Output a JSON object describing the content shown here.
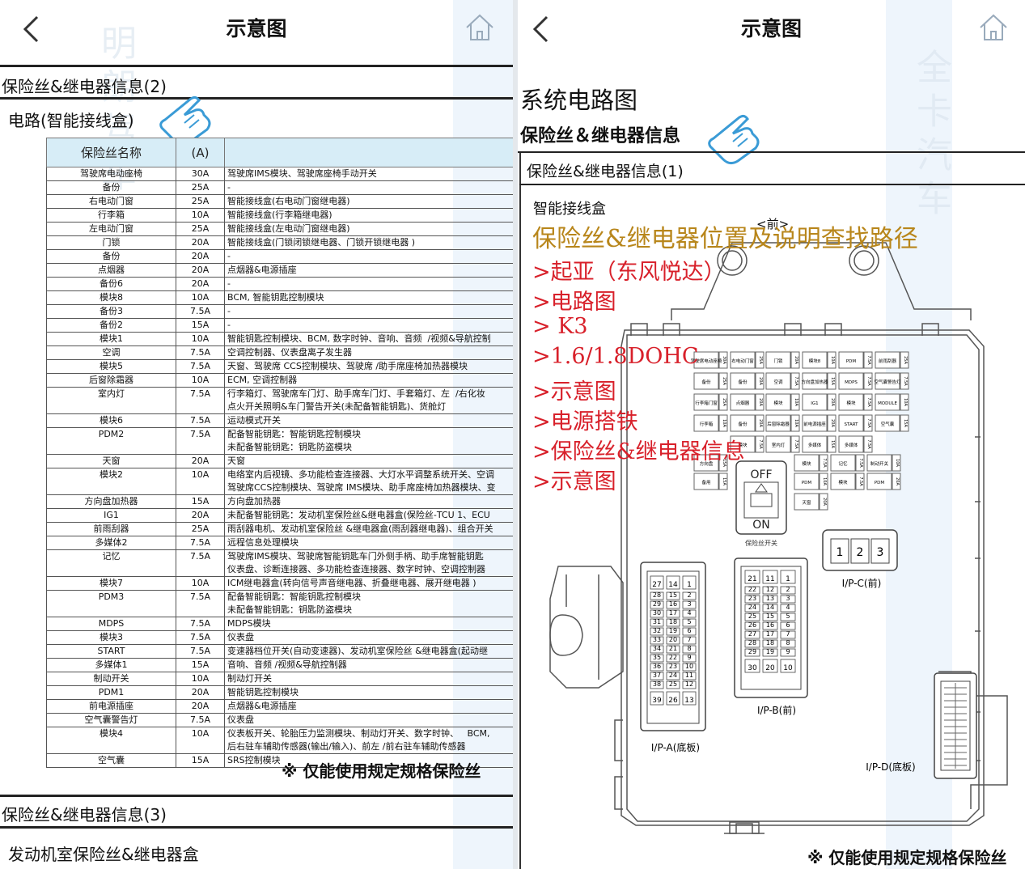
{
  "left_screen": {
    "header": {
      "title": "示意图",
      "back_icon": "chevron-left-icon",
      "home_icon": "home-icon"
    },
    "section_title": "保险丝&继电器信息(2)",
    "subtitle": "电路(智能接线盒)",
    "table": {
      "columns": [
        "保险丝名称",
        "(A)",
        ""
      ],
      "rows": [
        {
          "name": "驾驶席电动座椅",
          "amp": "30A",
          "desc": "驾驶席IMS模块、驾驶席座椅手动开关"
        },
        {
          "name": "备份",
          "amp": "25A",
          "desc": "-"
        },
        {
          "name": "右电动门窗",
          "amp": "25A",
          "desc": "智能接线盒(右电动门窗继电器)"
        },
        {
          "name": "行李箱",
          "amp": "10A",
          "desc": "智能接线盒(行李箱继电器)"
        },
        {
          "name": "左电动门窗",
          "amp": "25A",
          "desc": "智能接线盒(左电动门窗继电器)"
        },
        {
          "name": "门锁",
          "amp": "20A",
          "desc": "智能接线盒(门锁闭锁继电器、门锁开锁继电器 )"
        },
        {
          "name": "备份",
          "amp": "20A",
          "desc": "-"
        },
        {
          "name": "点烟器",
          "amp": "20A",
          "desc": "点烟器&电源插座"
        },
        {
          "name": "备份6",
          "amp": "20A",
          "desc": "-"
        },
        {
          "name": "模块8",
          "amp": "10A",
          "desc": "BCM, 智能钥匙控制模块"
        },
        {
          "name": "备份3",
          "amp": "7.5A",
          "desc": "-"
        },
        {
          "name": "备份2",
          "amp": "15A",
          "desc": "-"
        },
        {
          "name": "模块1",
          "amp": "10A",
          "desc": "智能钥匙控制模块、BCM, 数字时钟、音响、音频  /视频&导航控制"
        },
        {
          "name": "空调",
          "amp": "7.5A",
          "desc": "空调控制器、仪表盘离子发生器"
        },
        {
          "name": "模块5",
          "amp": "7.5A",
          "desc": "天窗、驾驶席 CCS控制模块、驾驶席 /助手席座椅加热器模块"
        },
        {
          "name": "后窗除霜器",
          "amp": "10A",
          "desc": "ECM, 空调控制器"
        },
        {
          "name": "室内灯",
          "amp": "7.5A",
          "desc": "行李箱灯、驾驶席车门灯、助手席车门灯、手套箱灯、左  /右化妆\n点火开关照明&车门警告开关(未配备智能钥匙)、货舱灯"
        },
        {
          "name": "模块6",
          "amp": "7.5A",
          "desc": "运动模式开关"
        },
        {
          "name": "PDM2",
          "amp": "7.5A",
          "desc": "配备智能钥匙：智能钥匙控制模块\n未配备智能钥匙：钥匙防盗模块"
        },
        {
          "name": "天窗",
          "amp": "20A",
          "desc": "天窗"
        },
        {
          "name": "模块2",
          "amp": "10A",
          "desc": "电络室内后视镜、多功能检查连接器、大灯水平调整系统开关、空调\n驾驶席CCS控制模块、驾驶席 IMS模块、助手席座椅加热器模块、变"
        },
        {
          "name": "方向盘加热器",
          "amp": "15A",
          "desc": "方向盘加热器"
        },
        {
          "name": "IG1",
          "amp": "20A",
          "desc": "未配备智能钥匙：发动机室保险丝&继电器盒(保险丝-TCU 1、ECU"
        },
        {
          "name": "前雨刮器",
          "amp": "25A",
          "desc": "雨刮器电机、发动机室保险丝 &继电器盒(雨刮器继电器)、组合开关"
        },
        {
          "name": "多媒体2",
          "amp": "7.5A",
          "desc": "远程信息处理模块"
        },
        {
          "name": "记忆",
          "amp": "7.5A",
          "desc": "驾驶席IMS模块、驾驶席智能钥匙车门外侧手柄、助手席智能钥匙\n仪表盘、诊断连接器、多功能检查连接器、数字时钟、空调控制器"
        },
        {
          "name": "模块7",
          "amp": "10A",
          "desc": "ICM继电器盒(转向信号声音继电器、折叠继电器、展开继电器 )"
        },
        {
          "name": "PDM3",
          "amp": "7.5A",
          "desc": "配备智能钥匙：智能钥匙控制模块\n未配备智能钥匙：钥匙防盗模块"
        },
        {
          "name": "MDPS",
          "amp": "7.5A",
          "desc": "MDPS模块"
        },
        {
          "name": "模块3",
          "amp": "7.5A",
          "desc": "仪表盘"
        },
        {
          "name": "START",
          "amp": "7.5A",
          "desc": "变速器档位开关(自动变速器)、发动机室保险丝 &继电器盒(起动继"
        },
        {
          "name": "多媒体1",
          "amp": "15A",
          "desc": "音响、音频 /视频&导航控制器"
        },
        {
          "name": "制动开关",
          "amp": "10A",
          "desc": "制动灯开关"
        },
        {
          "name": "PDM1",
          "amp": "20A",
          "desc": "智能钥匙控制模块"
        },
        {
          "name": "前电源插座",
          "amp": "20A",
          "desc": "点烟器&电源插座"
        },
        {
          "name": "空气囊警告灯",
          "amp": "7.5A",
          "desc": "仪表盘"
        },
        {
          "name": "模块4",
          "amp": "10A",
          "desc": "仪表板开关、轮胎压力监测模块、制动灯开关、数字时钟、   BCM,\n后右驻车辅助传感器(输出/输入)、前左 /前右驻车辅助传感器"
        },
        {
          "name": "空气囊",
          "amp": "15A",
          "desc": "SRS控制模块"
        }
      ]
    },
    "warning": "※ 仅能使用规定规格保险丝",
    "next_section_title": "保险丝&继电器信息(3)",
    "next_subtitle": "发动机室保险丝&继电器盒"
  },
  "right_screen": {
    "header": {
      "title": "示意图",
      "back_icon": "chevron-left-icon",
      "home_icon": "home-icon"
    },
    "page_heading": "系统电路图",
    "section_heading": "保险丝＆继电器信息",
    "section_title": "保险丝&继电器信息(1)",
    "diagram_title": "智能接线盒",
    "front_label": "<前>",
    "path_title": "保险丝&继电器位置及说明查找路径",
    "path_steps": [
      ">起亚（东风悦达）",
      ">电路图",
      "> K3",
      ">1.6/1.8DOHC",
      ">示意图",
      ">电源搭铁",
      ">保险丝&继电器信息",
      ">示意图"
    ],
    "switch": {
      "off": "OFF",
      "on": "ON",
      "caption": "保险丝开关"
    },
    "connectors": {
      "ipa": "I/P-A(底板)",
      "ipb": "I/P-B(前)",
      "ipc": "I/P-C(前)",
      "ipd": "I/P-D(底板)"
    },
    "ipc_pins": [
      "1",
      "2",
      "3"
    ],
    "ipa_top": [
      "27",
      "14",
      "1"
    ],
    "ipa_bottom": [
      "39",
      "26",
      "13"
    ],
    "ipa_grid": [
      [
        "28",
        "15",
        "2"
      ],
      [
        "29",
        "16",
        "3"
      ],
      [
        "30",
        "17",
        "4"
      ],
      [
        "31",
        "18",
        "5"
      ],
      [
        "32",
        "19",
        "6"
      ],
      [
        "33",
        "20",
        "7"
      ],
      [
        "34",
        "21",
        "8"
      ],
      [
        "35",
        "22",
        "9"
      ],
      [
        "36",
        "23",
        "10"
      ],
      [
        "37",
        "24",
        "11"
      ],
      [
        "38",
        "25",
        "12"
      ]
    ],
    "ipb_top": [
      "21",
      "11",
      "1"
    ],
    "ipb_bottom": [
      "30",
      "20",
      "10"
    ],
    "ipb_grid": [
      [
        "22",
        "12",
        "2"
      ],
      [
        "23",
        "13",
        "3"
      ],
      [
        "24",
        "14",
        "4"
      ],
      [
        "25",
        "15",
        "5"
      ],
      [
        "26",
        "16",
        "6"
      ],
      [
        "27",
        "17",
        "7"
      ],
      [
        "28",
        "18",
        "8"
      ],
      [
        "29",
        "19",
        "9"
      ]
    ],
    "fuse_rows": [
      [
        {
          "n": "驾驶席电动座椅",
          "a": "30A"
        },
        {
          "n": "右电动门窗",
          "a": "25A"
        },
        {
          "n": "门锁",
          "a": "20A"
        },
        {
          "n": "模块8",
          "a": "10A"
        },
        {
          "n": "PDM",
          "a": "7.5A"
        },
        {
          "n": "前雨刮器",
          "a": "25A"
        }
      ],
      [
        {
          "n": "备份",
          "a": "25A"
        },
        {
          "n": "备份",
          "a": "20A"
        },
        {
          "n": "空调",
          "a": "7.5A"
        },
        {
          "n": "方向盘加热器",
          "a": "15A"
        },
        {
          "n": "MDPS",
          "a": "7.5A"
        },
        {
          "n": "空气囊警告灯",
          "a": "7.5A"
        }
      ],
      [
        {
          "n": "行李箱门窗",
          "a": "25A"
        },
        {
          "n": "点烟器",
          "a": "20A"
        },
        {
          "n": "模块",
          "a": "10A"
        },
        {
          "n": "IG1",
          "a": "20A"
        },
        {
          "n": "模块",
          "a": "7.5A"
        },
        {
          "n": "MODULE",
          "a": "10A"
        }
      ],
      [
        {
          "n": "行李箱",
          "a": "10A"
        },
        {
          "n": "备份",
          "a": "20A"
        },
        {
          "n": "后窗除霜器",
          "a": "10A"
        },
        {
          "n": "前电源插座",
          "a": "20A"
        },
        {
          "n": "START",
          "a": "7.5A"
        },
        {
          "n": "空气囊",
          "a": "15A"
        }
      ],
      [
        {
          "n": "模块",
          "a": "7.5A"
        },
        {
          "n": "室内灯",
          "a": "7.5A"
        },
        {
          "n": "多媒体",
          "a": "15A"
        },
        {
          "n": "多媒体",
          "a": "7.5A"
        }
      ],
      [
        {
          "n": "方向盘",
          "a": "15A"
        },
        {
          "n": "模块",
          "a": "7.5A"
        },
        {
          "n": "记忆",
          "a": "7.5A"
        },
        {
          "n": "制动开关",
          "a": "10A"
        }
      ],
      [
        {
          "n": "备用",
          "a": "15A"
        },
        {
          "n": "PDM",
          "a": "10A"
        },
        {
          "n": "模块",
          "a": "7.5A"
        },
        {
          "n": "PDM",
          "a": "20A"
        }
      ],
      [
        {
          "n": "天窗",
          "a": "20A"
        }
      ]
    ],
    "warning": "※ 仅能使用规定规格保险丝"
  },
  "colors": {
    "table_header_bg": "#d7edf7",
    "path_title": "#b8861b",
    "path_steps": "#d8202a",
    "watermark_stripe": "#eaf3fb",
    "diagram_line": "#555555"
  }
}
